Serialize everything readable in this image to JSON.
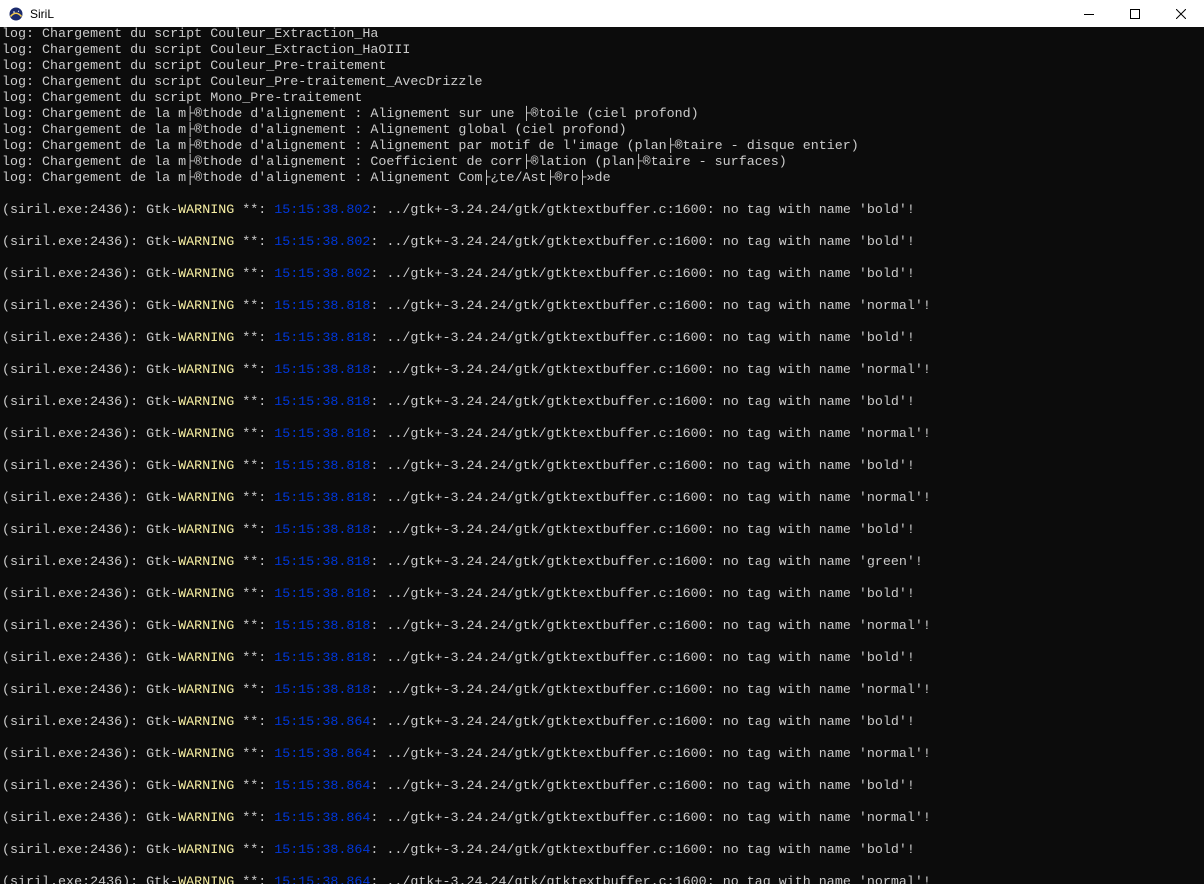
{
  "window": {
    "title": "SiriL",
    "icon": "siril-app-icon",
    "controls": [
      "minimize-icon",
      "maximize-icon",
      "close-icon"
    ]
  },
  "console": {
    "log_lines": [
      "log: Chargement du script Couleur_Extraction_Ha",
      "log: Chargement du script Couleur_Extraction_HaOIII",
      "log: Chargement du script Couleur_Pre-traitement",
      "log: Chargement du script Couleur_Pre-traitement_AvecDrizzle",
      "log: Chargement du script Mono_Pre-traitement",
      "log: Chargement de la m├®thode d'alignement : Alignement sur une ├®toile (ciel profond)",
      "log: Chargement de la m├®thode d'alignement : Alignement global (ciel profond)",
      "log: Chargement de la m├®thode d'alignement : Alignement par motif de l'image (plan├®taire - disque entier)",
      "log: Chargement de la m├®thode d'alignement : Coefficient de corr├®lation (plan├®taire - surfaces)",
      "log: Chargement de la m├®thode d'alignement : Alignement Com├¿te/Ast├®ro├»de"
    ],
    "warning_prefix": "(siril.exe:2436): Gtk-",
    "warning_label": "WARNING",
    "warning_sep": " **: ",
    "warning_path": ": ../gtk+-3.24.24/gtk/gtktextbuffer.c:1600: no tag with name ",
    "warnings": [
      {
        "time": "15:15:38.802",
        "tag": "'bold'!"
      },
      {
        "time": "15:15:38.802",
        "tag": "'bold'!"
      },
      {
        "time": "15:15:38.802",
        "tag": "'bold'!"
      },
      {
        "time": "15:15:38.818",
        "tag": "'normal'!"
      },
      {
        "time": "15:15:38.818",
        "tag": "'bold'!"
      },
      {
        "time": "15:15:38.818",
        "tag": "'normal'!"
      },
      {
        "time": "15:15:38.818",
        "tag": "'bold'!"
      },
      {
        "time": "15:15:38.818",
        "tag": "'normal'!"
      },
      {
        "time": "15:15:38.818",
        "tag": "'bold'!"
      },
      {
        "time": "15:15:38.818",
        "tag": "'normal'!"
      },
      {
        "time": "15:15:38.818",
        "tag": "'bold'!"
      },
      {
        "time": "15:15:38.818",
        "tag": "'green'!"
      },
      {
        "time": "15:15:38.818",
        "tag": "'bold'!"
      },
      {
        "time": "15:15:38.818",
        "tag": "'normal'!"
      },
      {
        "time": "15:15:38.818",
        "tag": "'bold'!"
      },
      {
        "time": "15:15:38.818",
        "tag": "'normal'!"
      },
      {
        "time": "15:15:38.864",
        "tag": "'bold'!"
      },
      {
        "time": "15:15:38.864",
        "tag": "'normal'!"
      },
      {
        "time": "15:15:38.864",
        "tag": "'bold'!"
      },
      {
        "time": "15:15:38.864",
        "tag": "'normal'!"
      },
      {
        "time": "15:15:38.864",
        "tag": "'bold'!"
      },
      {
        "time": "15:15:38.864",
        "tag": "'normal'!"
      }
    ]
  },
  "colors": {
    "background": "#0c0c0c",
    "text": "#cccccc",
    "warning": "#f9f1a5",
    "timestamp": "#0037da"
  }
}
